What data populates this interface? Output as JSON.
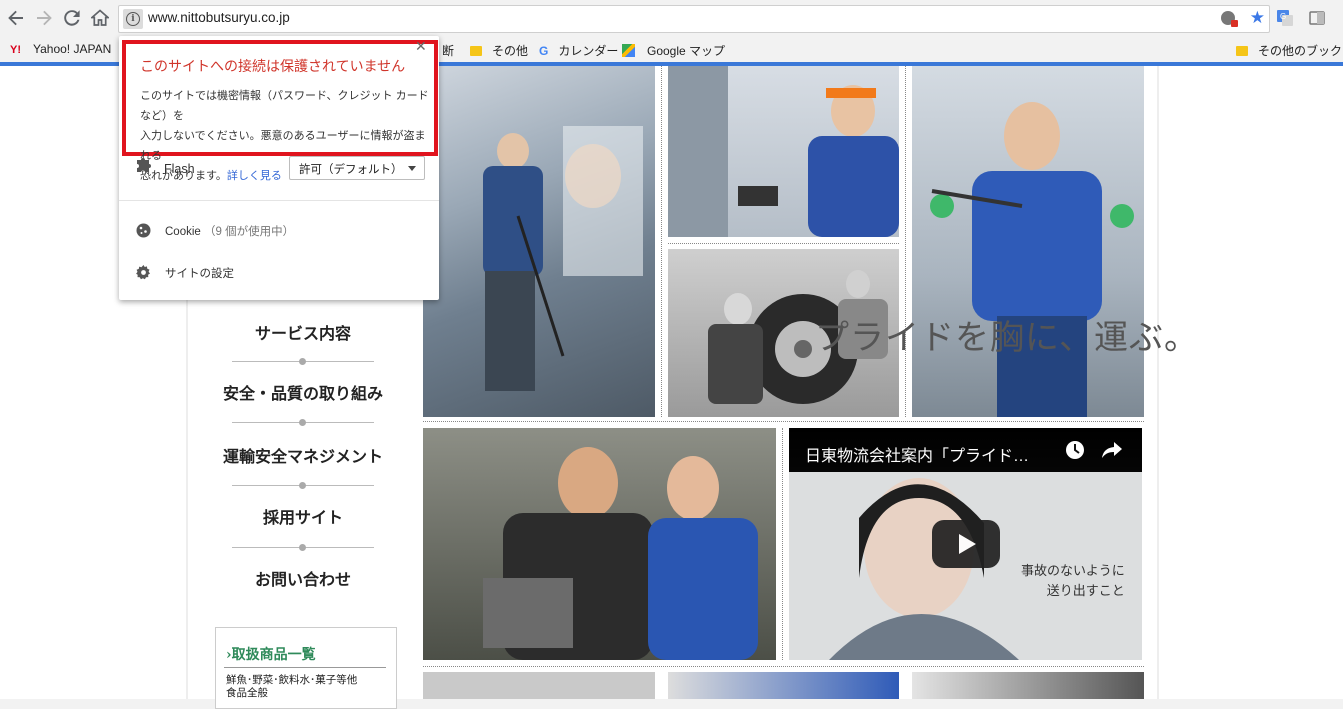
{
  "browser": {
    "url": "www.nittobutsuryu.co.jp",
    "bookmarks": [
      {
        "label": "Yahoo! JAPAN",
        "icon": "yahoo-icon"
      },
      {
        "label": "断",
        "icon": "folder-icon"
      },
      {
        "label": "その他",
        "icon": "folder-icon"
      },
      {
        "label": "カレンダー",
        "icon": "google-icon"
      },
      {
        "label": "Google マップ",
        "icon": "maps-icon"
      },
      {
        "label": "その他のブックマーク",
        "icon": "folder-icon"
      }
    ],
    "accent": "#3a78d8"
  },
  "site_info_popup": {
    "warning_title": "このサイトへの接続は保護されていません",
    "warning_line1": "このサイトでは機密情報（パスワード、クレジット カードなど）を",
    "warning_line2": "入力しないでください。悪意のあるユーザーに情報が盗まれる",
    "warning_line3": "恐れがあります。",
    "learn_more": "詳しく見る",
    "flash_label": "Flash",
    "flash_value": "許可（デフォルト）",
    "cookie_label": "Cookie",
    "cookie_count": "（9 個が使用中）",
    "site_settings": "サイトの設定",
    "warning_color": "#e0141e"
  },
  "page": {
    "menu": [
      {
        "label": "サービス内容"
      },
      {
        "label": "安全・品質の取り組み"
      },
      {
        "label": "運輸安全マネジメント"
      },
      {
        "label": "採用サイト"
      },
      {
        "label": "お問い合わせ"
      }
    ],
    "products_title": "取扱商品一覧",
    "products_desc_line1": "鮮魚･野菜･飲料水･菓子等他",
    "products_desc_line2": "食品全般",
    "tagline": "プライドを胸に、運ぶ。",
    "video_title": "日東物流会社案内「プライド…",
    "video_caption_line1": "事故のないように",
    "video_caption_line2": "送り出すこと"
  }
}
